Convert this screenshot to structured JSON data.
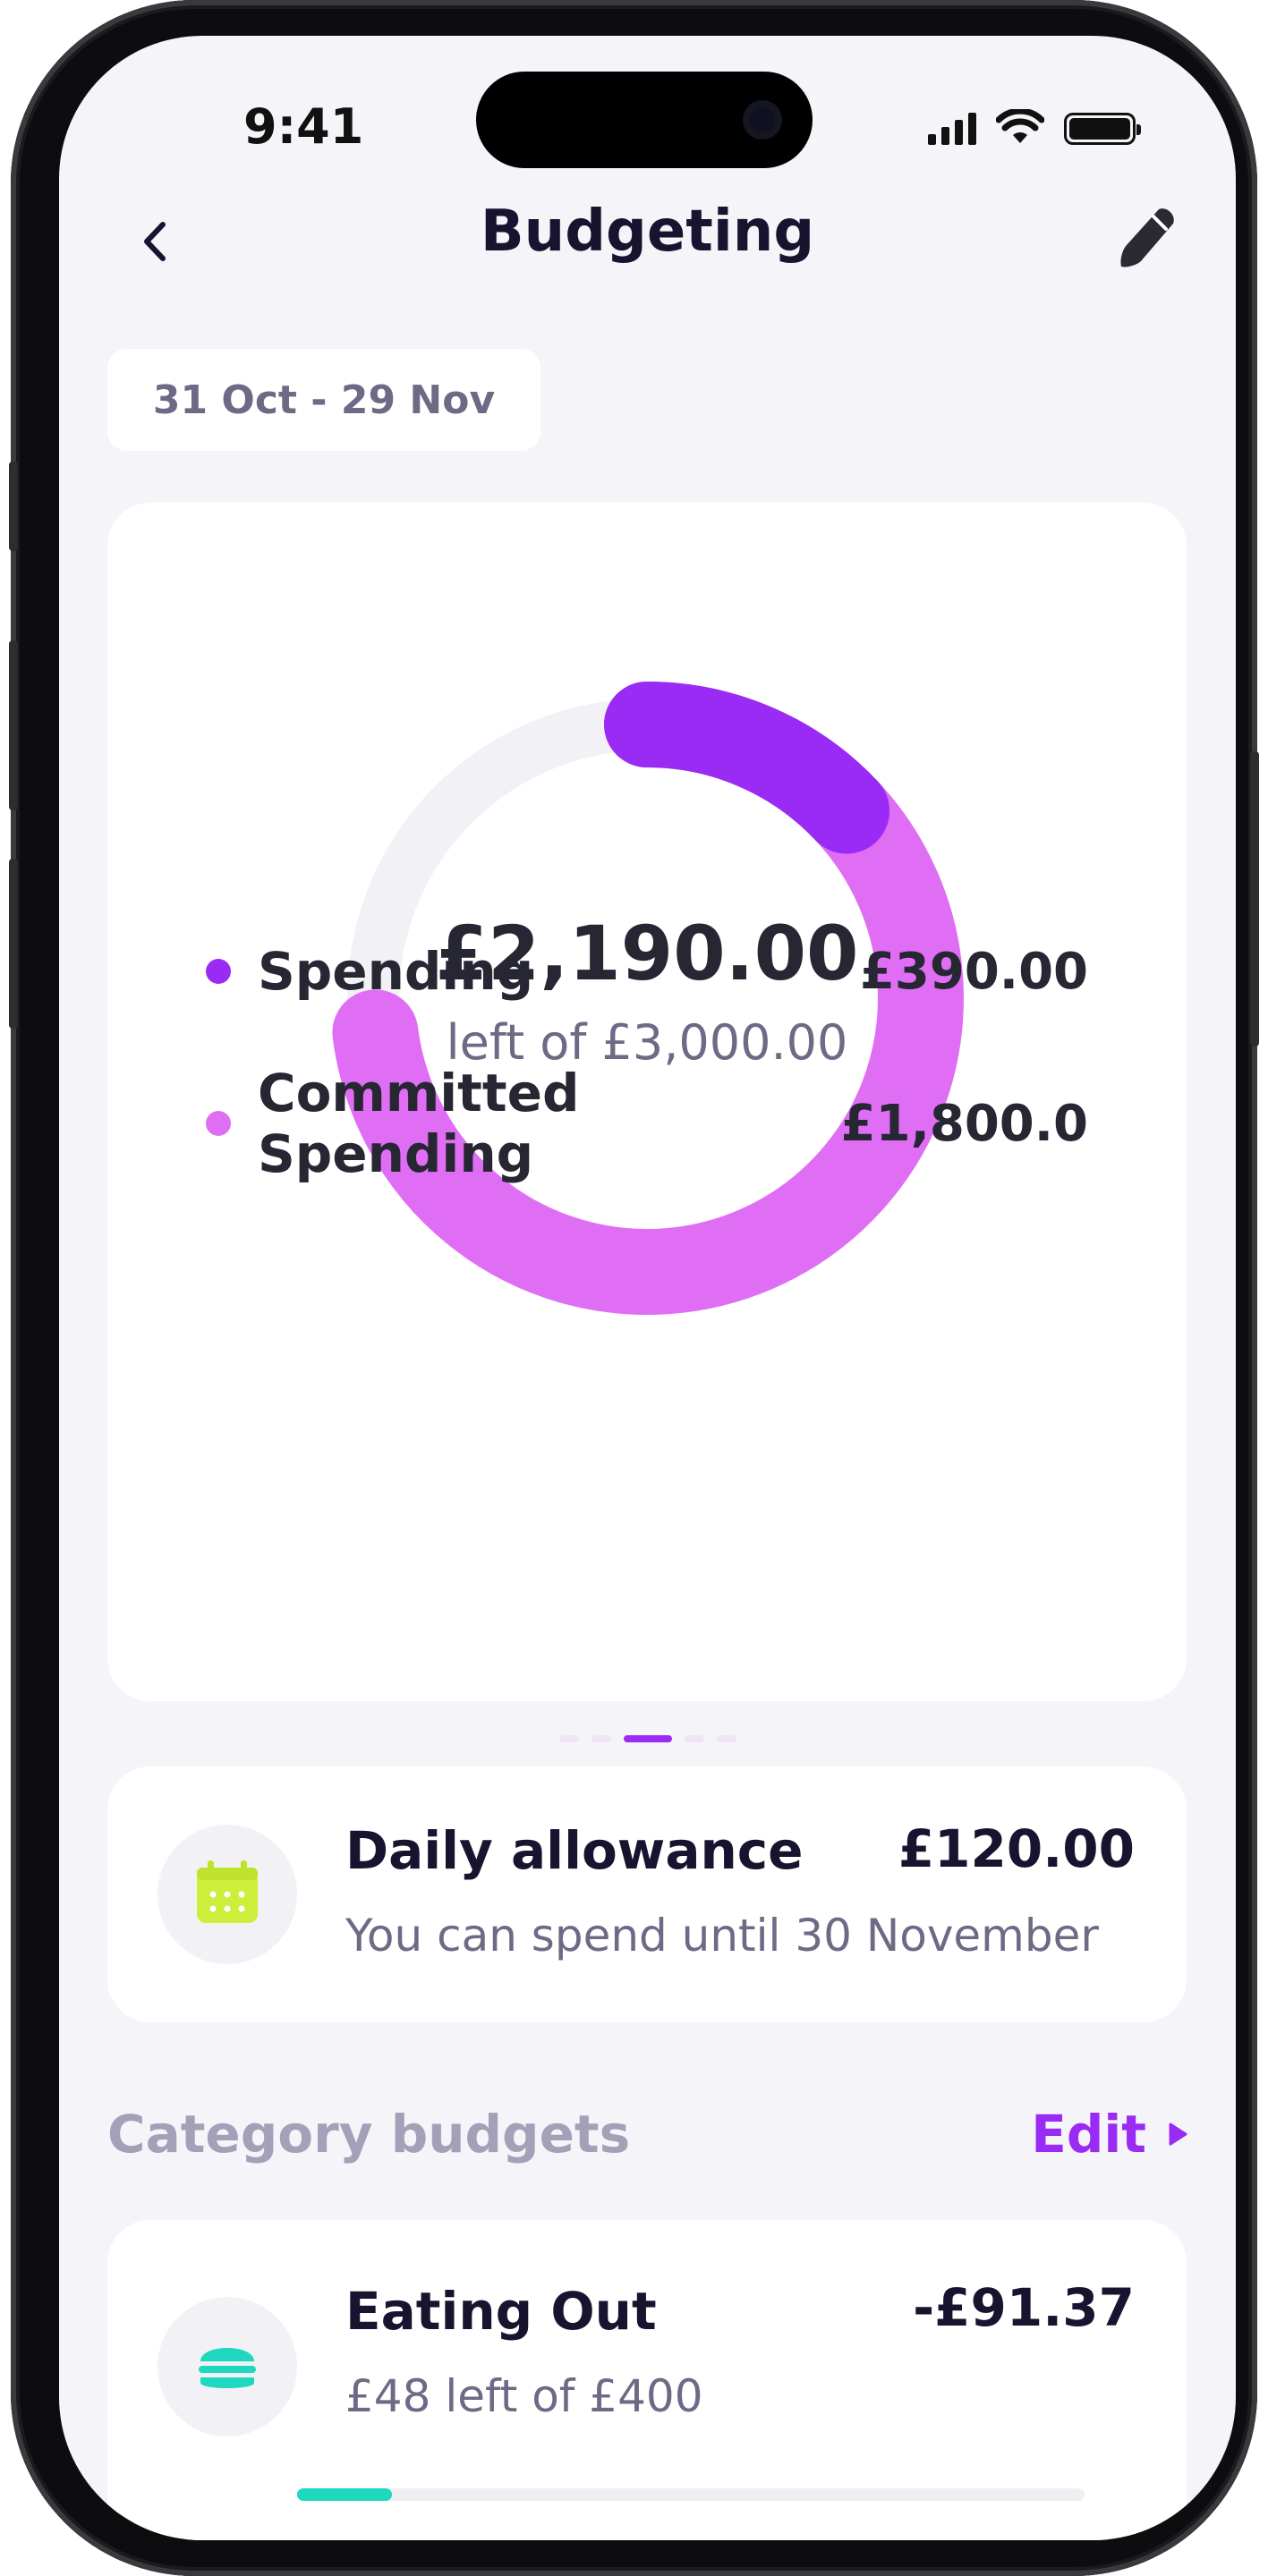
{
  "status_bar": {
    "time": "9:41"
  },
  "nav": {
    "title": "Budgeting"
  },
  "period": {
    "label": "31 Oct - 29 Nov"
  },
  "summary": {
    "remaining": "£2,190.00",
    "remaining_caption": "left of £3,000.00",
    "ring": {
      "total": 3000,
      "spending": 390,
      "committed": 1800,
      "colors": {
        "track": "#f2f2f6",
        "spending": "#9a2bf5",
        "committed": "#e06ef5"
      }
    },
    "legend": [
      {
        "label": "Spending",
        "value": "£390.00",
        "color": "#9a2bf5"
      },
      {
        "label": "Committed Spending",
        "value": "£1,800.0",
        "color": "#e06ef5"
      }
    ]
  },
  "pager": {
    "count": 5,
    "active_index": 2
  },
  "daily_allowance": {
    "title": "Daily allowance",
    "amount": "£120.00",
    "subtitle": "You can spend until 30 November",
    "icon": "calendar-icon",
    "icon_color": "#cdee3a"
  },
  "category_section": {
    "title": "Category budgets",
    "edit_label": "Edit"
  },
  "categories": [
    {
      "name": "Eating Out",
      "amount": "-£91.37",
      "subtitle": "£48 left of £400",
      "icon": "burger-icon",
      "icon_color": "#1fd8c0",
      "progress": 0.12
    }
  ],
  "colors": {
    "accent": "#9a2bf5",
    "text": "#17142f",
    "muted": "#6d6a85",
    "background": "#f5f5f9"
  }
}
